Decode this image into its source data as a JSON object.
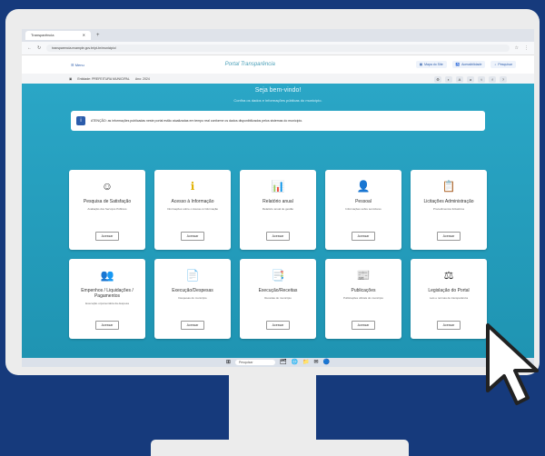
{
  "browser": {
    "tab_title": "Transparência",
    "url": "transparencia.example.gov.br/pt-br/municipio/",
    "icons": [
      "back-icon",
      "refresh-icon",
      "home-icon",
      "star-icon",
      "extensions-icon",
      "profile-icon"
    ]
  },
  "topnav": {
    "menu_label": "☰ Menu",
    "brand": "Portal Transparência",
    "buttons": [
      {
        "label": "Mapa do Site",
        "icon": "sitemap-icon"
      },
      {
        "label": "Acessibilidade",
        "icon": "accessibility-icon"
      },
      {
        "label": "Pesquisar",
        "icon": "search-icon"
      }
    ]
  },
  "toolbar": {
    "entity_label": "Entidade: PREFEITURA MUNICIPAL",
    "year_label": "Ano: 2024"
  },
  "hero": {
    "title": "Seja bem-vindo!",
    "subtitle": "Confira os dados e informações públicas do município."
  },
  "notice": {
    "text": "ATENÇÃO: as informações publicadas neste portal estão atualizadas em tempo real conforme os dados disponibilizados pelos sistemas do município."
  },
  "cards": [
    {
      "icon": "☺",
      "icon_name": "smiley-icon",
      "title": "Pesquisa de Satisfação",
      "desc": "Avaliação dos Serviços Públicos",
      "btn": "Acessar"
    },
    {
      "icon": "ℹ",
      "icon_name": "info-icon",
      "title": "Acesso à Informação",
      "desc": "Informações sobre o Acesso à Informação",
      "btn": "Acessar"
    },
    {
      "icon": "📊",
      "icon_name": "chart-icon",
      "title": "Relatório anual",
      "desc": "Relatório anual de gestão",
      "btn": "Acessar"
    },
    {
      "icon": "👤",
      "icon_name": "person-icon",
      "title": "Pessoal",
      "desc": "Informações sobre servidores",
      "btn": "Acessar"
    },
    {
      "icon": "📋",
      "icon_name": "clipboard-icon",
      "title": "Licitações Administração",
      "desc": "Procedimentos licitatórios",
      "btn": "Acessar"
    },
    {
      "icon": "👥",
      "icon_name": "group-icon",
      "title": "Empenhos / Liquidações / Pagamentos",
      "desc": "Execução orçamentária da despesa",
      "btn": "Acessar"
    },
    {
      "icon": "📄",
      "icon_name": "document-icon",
      "title": "Execução/Despesas",
      "desc": "Despesas do município",
      "btn": "Acessar"
    },
    {
      "icon": "📑",
      "icon_name": "file-icon",
      "title": "Execução/Receitas",
      "desc": "Receitas do município",
      "btn": "Acessar"
    },
    {
      "icon": "📰",
      "icon_name": "newspaper-icon",
      "title": "Publicações",
      "desc": "Publicações oficiais do município",
      "btn": "Acessar"
    },
    {
      "icon": "⚖",
      "icon_name": "scales-icon",
      "title": "Legislação do Portal",
      "desc": "Leis e normas de transparência",
      "btn": "Acessar"
    }
  ],
  "taskbar": {
    "search_placeholder": "Pesquisar",
    "apps": [
      "⊞",
      "🗂",
      "🌐",
      "📁",
      "✉",
      "🔵"
    ]
  }
}
